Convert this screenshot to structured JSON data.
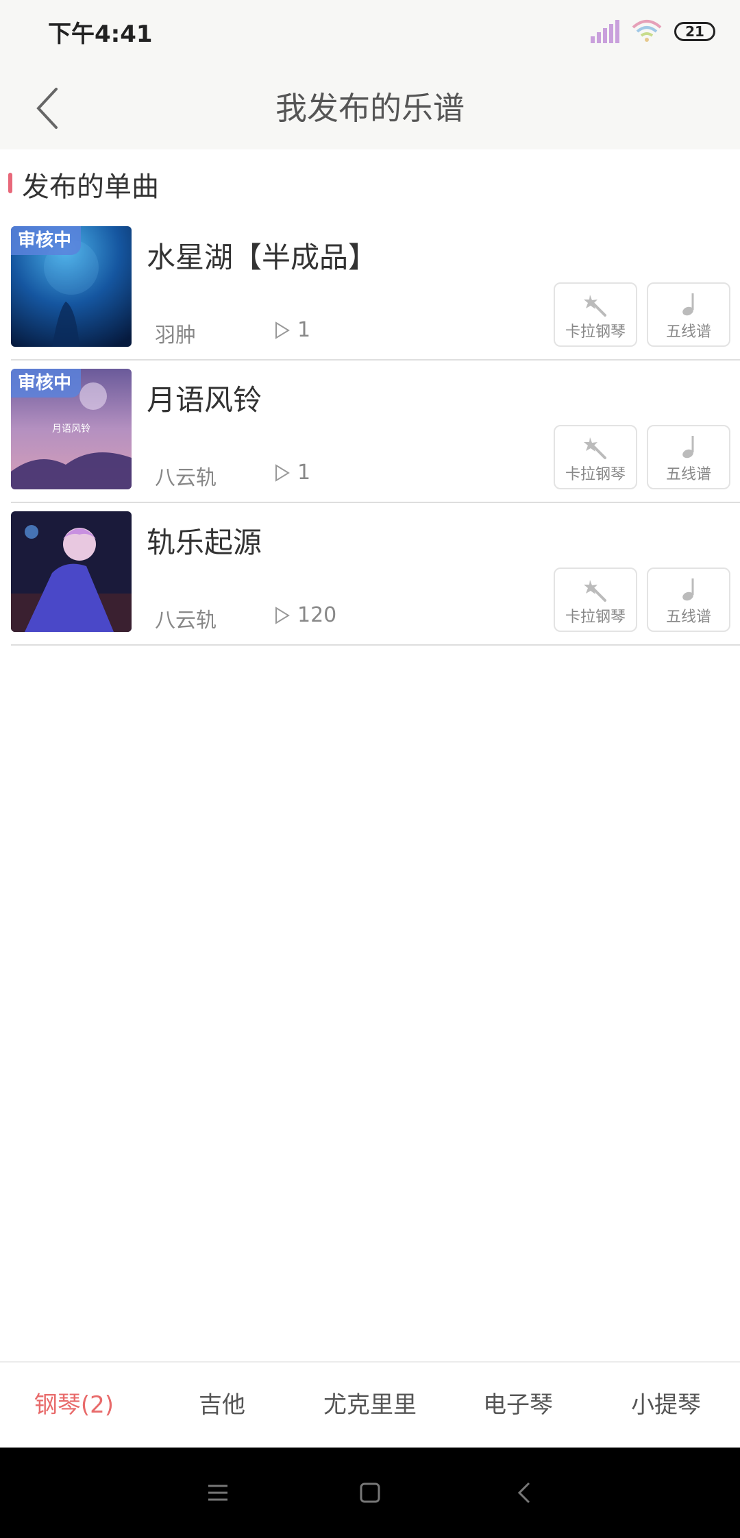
{
  "status_bar": {
    "time": "下午4:41",
    "battery": "21"
  },
  "header": {
    "title": "我发布的乐谱"
  },
  "section": {
    "title": "发布的单曲"
  },
  "songs": [
    {
      "title": "水星湖【半成品】",
      "author": "羽肿",
      "plays": "1",
      "badge": "审核中",
      "btn_karaoke": "卡拉钢琴",
      "btn_staff": "五线谱"
    },
    {
      "title": "月语风铃",
      "author": "八云轨",
      "plays": "1",
      "badge": "审核中",
      "btn_karaoke": "卡拉钢琴",
      "btn_staff": "五线谱",
      "cover_text": "月语风铃"
    },
    {
      "title": "轨乐起源",
      "author": "八云轨",
      "plays": "120",
      "btn_karaoke": "卡拉钢琴",
      "btn_staff": "五线谱"
    }
  ],
  "tabs": [
    {
      "label": "钢琴(2)",
      "active": true
    },
    {
      "label": "吉他"
    },
    {
      "label": "尤克里里"
    },
    {
      "label": "电子琴"
    },
    {
      "label": "小提琴"
    }
  ],
  "colors": {
    "accent": "#e86a6a",
    "section_bar": "#e8687a",
    "badge": "#5a82dc"
  }
}
